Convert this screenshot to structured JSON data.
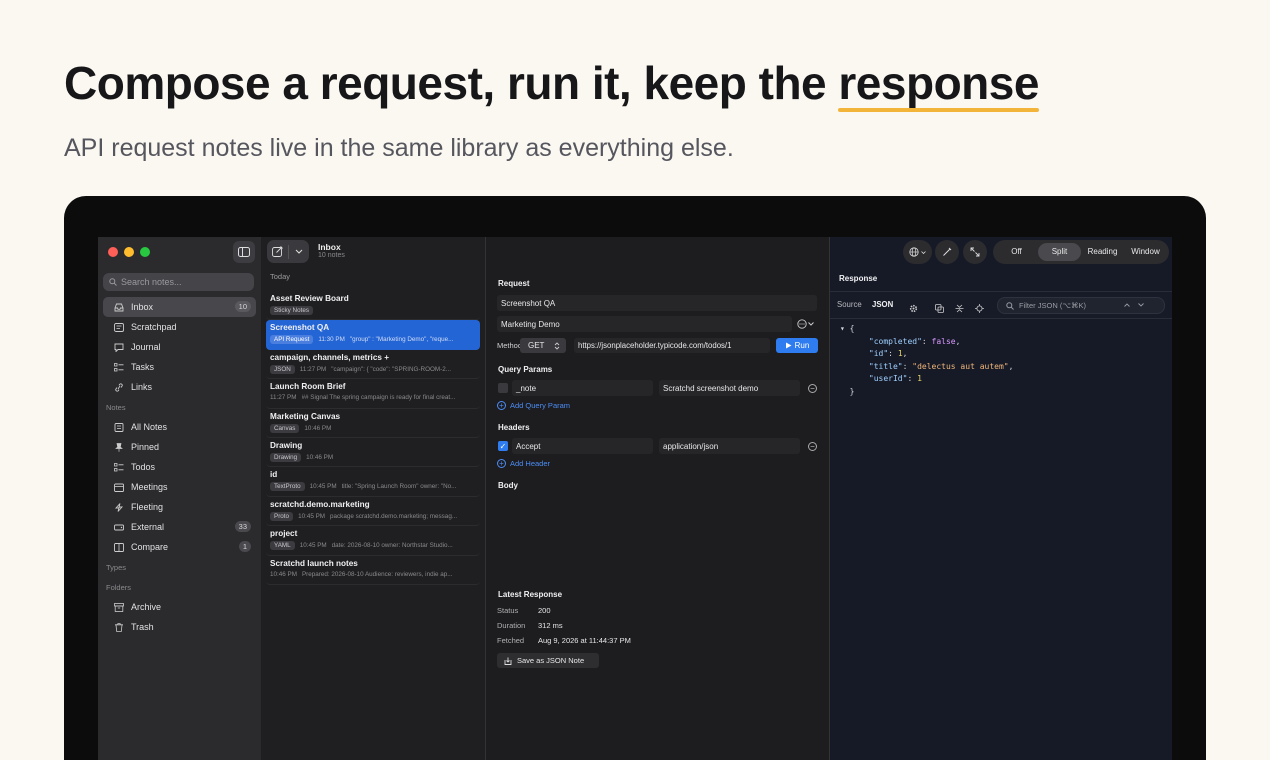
{
  "hero": {
    "title_prefix": "Compose a request, run it, keep the ",
    "title_highlight": "response",
    "subtitle": "API request notes live in the same library as everything else."
  },
  "sidebar": {
    "search_placeholder": "Search notes...",
    "items": [
      {
        "label": "Inbox",
        "icon": "tray-icon",
        "count": "10"
      },
      {
        "label": "Scratchpad",
        "icon": "scratchpad-icon",
        "count": null
      },
      {
        "label": "Journal",
        "icon": "journal-icon",
        "count": null
      },
      {
        "label": "Tasks",
        "icon": "checklist-icon",
        "count": null
      },
      {
        "label": "Links",
        "icon": "link-icon",
        "count": null
      }
    ],
    "notes_section": "Notes",
    "notes_items": [
      {
        "label": "All Notes",
        "icon": "notes-icon",
        "count": null
      },
      {
        "label": "Pinned",
        "icon": "pin-icon",
        "count": null
      },
      {
        "label": "Todos",
        "icon": "checklist-icon",
        "count": null
      },
      {
        "label": "Meetings",
        "icon": "calendar-icon",
        "count": null
      },
      {
        "label": "Fleeting",
        "icon": "fleeting-icon",
        "count": null
      },
      {
        "label": "External",
        "icon": "drive-icon",
        "count": "33"
      },
      {
        "label": "Compare",
        "icon": "compare-icon",
        "count": "1"
      }
    ],
    "types_section": "Types",
    "folders_section": "Folders",
    "folder_items": [
      {
        "label": "Archive",
        "icon": "archive-icon"
      },
      {
        "label": "Trash",
        "icon": "trash-icon"
      }
    ]
  },
  "note_list": {
    "title": "Inbox",
    "count": "10 notes",
    "group": "Today",
    "notes": [
      {
        "title": "Asset Review Board",
        "tag": "Sticky Notes",
        "time": "",
        "preview": ""
      },
      {
        "title": "Screenshot QA",
        "tag": "API Request",
        "time": "11:30 PM",
        "preview": "\"group\" : \"Marketing Demo\",  \"reque..."
      },
      {
        "title": "campaign, channels, metrics +",
        "tag": "JSON",
        "time": "11:27 PM",
        "preview": "\"campaign\": {   \"code\": \"SPRING-ROOM-2..."
      },
      {
        "title": "Launch Room Brief",
        "tag": "",
        "time": "11:27 PM",
        "preview": "## Signal The spring campaign is ready for final creat..."
      },
      {
        "title": "Marketing Canvas",
        "tag": "Canvas",
        "time": "10:46 PM",
        "preview": ""
      },
      {
        "title": "Drawing",
        "tag": "Drawing",
        "time": "10:46 PM",
        "preview": ""
      },
      {
        "title": "id",
        "tag": "TextProto",
        "time": "10:45 PM",
        "preview": "title: \"Spring Launch Room\" owner: \"No..."
      },
      {
        "title": "scratchd.demo.marketing",
        "tag": "Proto",
        "time": "10:45 PM",
        "preview": "package scratchd.demo.marketing; messag..."
      },
      {
        "title": "project",
        "tag": "YAML",
        "time": "10:45 PM",
        "preview": "date: 2026-08-10 owner: Northstar Studio..."
      },
      {
        "title": "Scratchd launch notes",
        "tag": "",
        "time": "10:46 PM",
        "preview": "Prepared: 2026-08-10 Audience: reviewers, indie ap..."
      }
    ]
  },
  "request": {
    "heading": "Request",
    "name": "Screenshot QA",
    "group": "Marketing Demo",
    "method_label": "Method",
    "method": "GET",
    "url": "https://jsonplaceholder.typicode.com/todos/1",
    "run_label": "Run",
    "query_heading": "Query Params",
    "query_key": "_note",
    "query_value": "Scratchd screenshot demo",
    "add_query": "Add Query Param",
    "headers_heading": "Headers",
    "header_key": "Accept",
    "header_value": "application/json",
    "add_header": "Add Header",
    "body_heading": "Body",
    "latest_heading": "Latest Response",
    "status_label": "Status",
    "status_value": "200",
    "duration_label": "Duration",
    "duration_value": "312 ms",
    "fetched_label": "Fetched",
    "fetched_value": "Aug 9, 2026 at 11:44:37 PM",
    "save_label": "Save as JSON Note"
  },
  "response": {
    "modes": [
      "Off",
      "Split",
      "Reading",
      "Window"
    ],
    "active_mode": "Split",
    "heading": "Response",
    "source_label": "Source",
    "json_label": "JSON",
    "filter_placeholder": "Filter JSON (⌥⌘K)",
    "json": {
      "completed": "false",
      "id": "1",
      "title": "\"delectus aut autem\"",
      "userId": "1"
    }
  },
  "colors": {
    "accent": "#2f7bf0",
    "highlight_underline": "#f2b53a",
    "selected_note": "#2465d5"
  }
}
